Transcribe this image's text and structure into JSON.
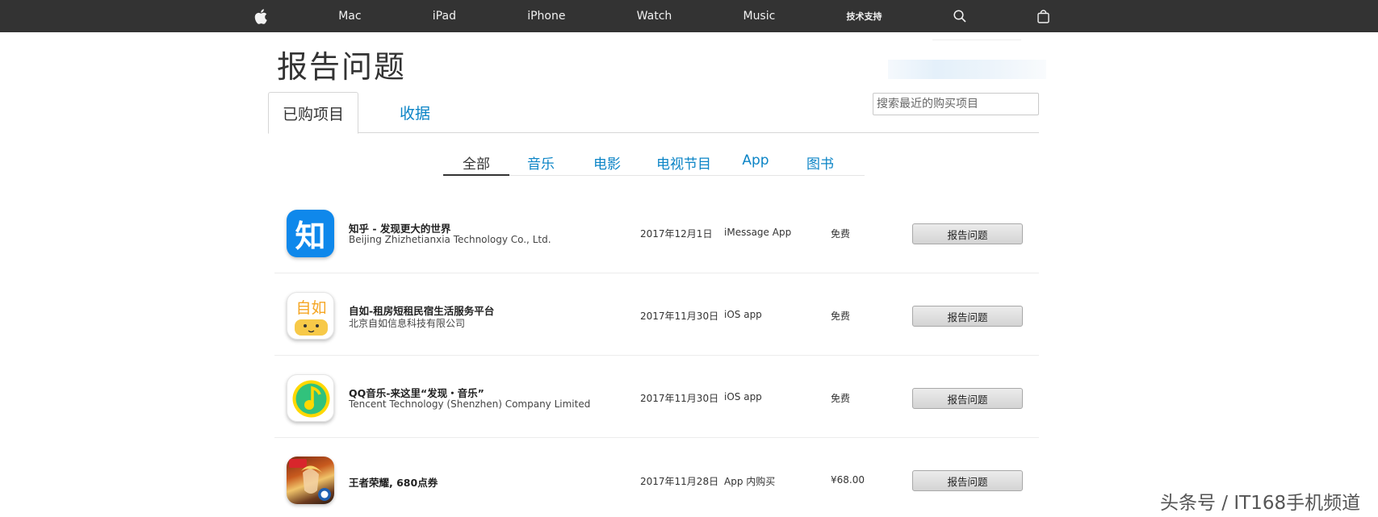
{
  "nav": {
    "items": [
      "Mac",
      "iPad",
      "iPhone",
      "Watch",
      "Music",
      "技术支持"
    ],
    "apple_icon": "apple-logo-icon",
    "search_icon": "search-icon",
    "bag_icon": "shopping-bag-icon"
  },
  "page": {
    "title": "报告问题"
  },
  "tabs": {
    "purchased": "已购项目",
    "receipts": "收据"
  },
  "search": {
    "placeholder": "搜索最近的购买项目"
  },
  "filters": {
    "all": "全部",
    "music": "音乐",
    "movies": "电影",
    "tv": "电视节目",
    "app": "App",
    "books": "图书"
  },
  "purchases": [
    {
      "name": "知乎 - 发现更大的世界",
      "developer": "Beijing Zhizhetianxia Technology Co., Ltd.",
      "date": "2017年12月1日",
      "type": "iMessage App",
      "price": "免费",
      "action": "报告问题",
      "icon_name": "zhihu-app-icon",
      "icon_text": "知"
    },
    {
      "name": "自如-租房短租民宿生活服务平台",
      "developer": "北京自如信息科技有限公司",
      "date": "2017年11月30日",
      "type": "iOS app",
      "price": "免费",
      "action": "报告问题",
      "icon_name": "ziroom-app-icon",
      "icon_text": "自如"
    },
    {
      "name": "QQ音乐-来这里“发现・音乐”",
      "developer": "Tencent Technology (Shenzhen) Company Limited",
      "date": "2017年11月30日",
      "type": "iOS app",
      "price": "免费",
      "action": "报告问题",
      "icon_name": "qq-music-app-icon"
    },
    {
      "name": "王者荣耀, 680点券",
      "developer": "",
      "date": "2017年11月28日",
      "type": "App 内购买",
      "price": "¥68.00",
      "action": "报告问题",
      "icon_name": "honor-of-kings-app-icon"
    }
  ],
  "watermark": "头条号 / IT168手机频道",
  "colors": {
    "nav_bg": "#333333",
    "link": "#0b84c6",
    "zhihu_blue": "#0f88eb",
    "ziroom_orange": "#f5a623",
    "qq_green": "#31c27c"
  }
}
